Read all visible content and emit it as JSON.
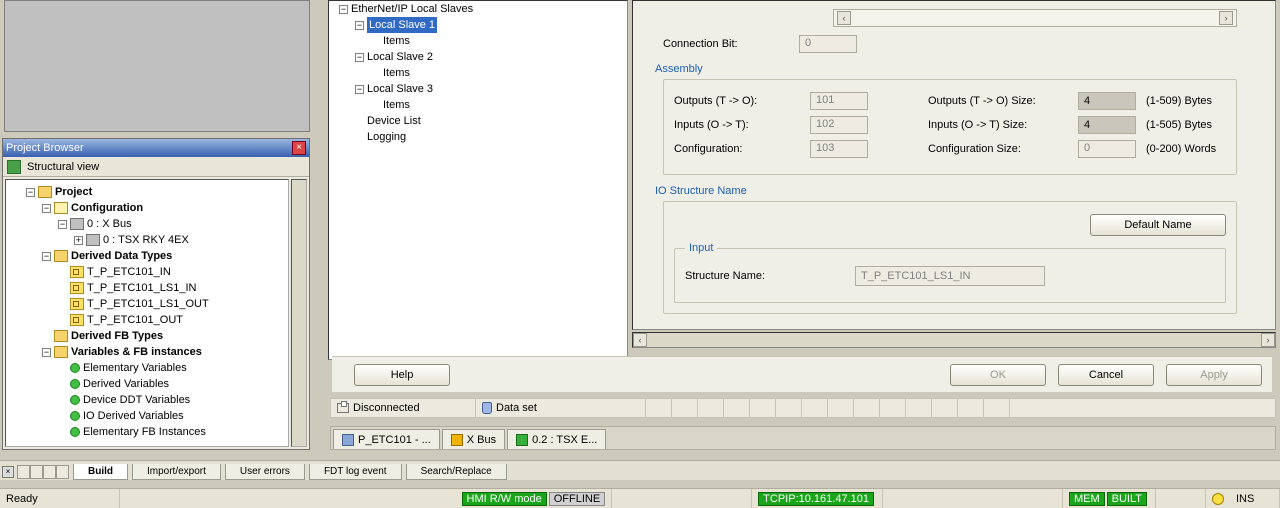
{
  "project_browser": {
    "title": "Project Browser",
    "subtitle": "Structural view",
    "tree": {
      "project": "Project",
      "configuration": "Configuration",
      "xbus": "0 : X Bus",
      "rky": "0 : TSX RKY 4EX",
      "ddt": "Derived Data Types",
      "ddt_items": [
        "T_P_ETC101_IN",
        "T_P_ETC101_LS1_IN",
        "T_P_ETC101_LS1_OUT",
        "T_P_ETC101_OUT"
      ],
      "dfb": "Derived FB Types",
      "vars": "Variables & FB instances",
      "var_items": [
        "Elementary Variables",
        "Derived Variables",
        "Device DDT Variables",
        "IO Derived Variables",
        "Elementary FB Instances"
      ]
    }
  },
  "device_tree": {
    "root": "EtherNet/IP Local Slaves",
    "slaves": [
      {
        "name": "Local Slave 1",
        "items": "Items",
        "selected": true
      },
      {
        "name": "Local Slave 2",
        "items": "Items",
        "selected": false
      },
      {
        "name": "Local Slave 3",
        "items": "Items",
        "selected": false
      }
    ],
    "device_list": "Device List",
    "logging": "Logging"
  },
  "form": {
    "conn_bit_label": "Connection Bit:",
    "conn_bit_value": "0",
    "assembly_title": "Assembly",
    "out_lbl": "Outputs (T -> O):",
    "out_val": "101",
    "out_size_lbl": "Outputs (T -> O) Size:",
    "out_size_val": "4",
    "out_size_rng": "(1-509) Bytes",
    "in_lbl": "Inputs (O -> T):",
    "in_val": "102",
    "in_size_lbl": "Inputs (O -> T) Size:",
    "in_size_val": "4",
    "in_size_rng": "(1-505) Bytes",
    "cfg_lbl": "Configuration:",
    "cfg_val": "103",
    "cfg_size_lbl": "Configuration Size:",
    "cfg_size_val": "0",
    "cfg_size_rng": "(0-200) Words",
    "io_struct_title": "IO Structure Name",
    "default_btn": "Default Name",
    "input_title": "Input",
    "struct_lbl": "Structure Name:",
    "struct_val": "T_P_ETC101_LS1_IN"
  },
  "dialog_buttons": {
    "help": "Help",
    "ok": "OK",
    "cancel": "Cancel",
    "apply": "Apply"
  },
  "conn_strip": {
    "disc": "Disconnected",
    "dataset": "Data set"
  },
  "doc_tabs": {
    "t1": "P_ETC101 - ...",
    "t2": "X Bus",
    "t3": "0.2 : TSX E..."
  },
  "out_tabs": [
    "Build",
    "Import/export",
    "User errors",
    "FDT log event",
    "Search/Replace"
  ],
  "status": {
    "ready": "Ready",
    "hmi": "HMI R/W mode",
    "offline": "OFFLINE",
    "tcpip": "TCPIP:10.161.47.101",
    "mem": "MEM",
    "built": "BUILT",
    "ins": "INS"
  }
}
